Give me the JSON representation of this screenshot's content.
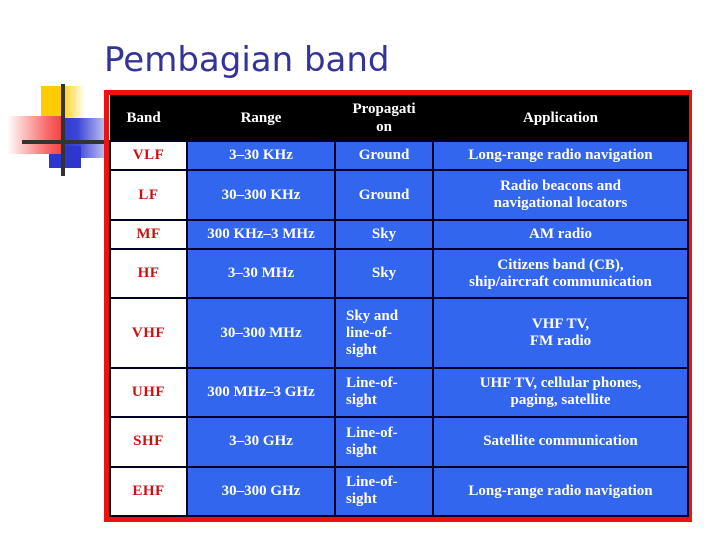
{
  "slide": {
    "title": "Pembagian band",
    "title_color": "#333399",
    "background": "#ffffff"
  },
  "decoration": {
    "name": "corner-logo",
    "shapes": [
      "yellow-square",
      "red-square",
      "blue-square",
      "blue-square-small",
      "crosshair-vertical",
      "crosshair-horizontal"
    ],
    "colors": {
      "yellow": "#FFCC00",
      "red": "#F43E3E",
      "blue": "#2F36CC",
      "crosshair": "#333333"
    }
  },
  "table": {
    "border_color": "#EE1111",
    "header_background": "#000000",
    "header_text_color": "#ffffff",
    "cell_background": "#3366EE",
    "cell_text_color": "#ffffff",
    "band_cell_background": "#ffffff",
    "band_cell_text_color": "#CC1111",
    "headers": {
      "band": "Band",
      "range": "Range",
      "propagation_line1": "Propagati",
      "propagation_line2": "on",
      "application": "Application"
    },
    "rows": [
      {
        "band": "VLF",
        "range": "3–30 KHz",
        "propagation": [
          "Ground"
        ],
        "application": [
          "Long-range radio navigation"
        ]
      },
      {
        "band": "LF",
        "range": "30–300 KHz",
        "propagation": [
          "Ground"
        ],
        "application": [
          "Radio beacons and",
          "navigational locators"
        ]
      },
      {
        "band": "MF",
        "range": "300 KHz–3 MHz",
        "propagation": [
          "Sky"
        ],
        "application": [
          "AM radio"
        ]
      },
      {
        "band": "HF",
        "range": "3–30 MHz",
        "propagation": [
          "Sky"
        ],
        "application": [
          "Citizens band (CB),",
          "ship/aircraft communication"
        ]
      },
      {
        "band": "VHF",
        "range": "30–300 MHz",
        "propagation": [
          "Sky and",
          "line-of-",
          "sight"
        ],
        "application": [
          "VHF TV,",
          "FM radio"
        ]
      },
      {
        "band": "UHF",
        "range": "300 MHz–3 GHz",
        "propagation": [
          "Line-of-",
          "sight"
        ],
        "application": [
          "UHF TV, cellular phones,",
          "paging, satellite"
        ]
      },
      {
        "band": "SHF",
        "range": "3–30 GHz",
        "propagation": [
          "Line-of-",
          "sight"
        ],
        "application": [
          "Satellite communication"
        ]
      },
      {
        "band": "EHF",
        "range": "30–300 GHz",
        "propagation": [
          "Line-of-",
          "sight"
        ],
        "application": [
          "Long-range radio navigation"
        ]
      }
    ]
  }
}
